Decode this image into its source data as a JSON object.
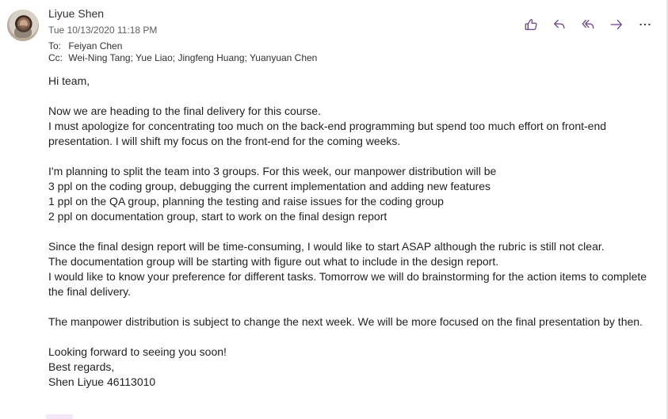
{
  "message": {
    "sender": "Liyue Shen",
    "date": "Tue 10/13/2020 11:18 PM",
    "to_label": "To:",
    "to": "Feiyan Chen",
    "cc_label": "Cc:",
    "cc": "Wei-Ning Tang; Yue Liao; Jingfeng Huang; Yuanyuan Chen"
  },
  "actions": [
    {
      "name": "like-button",
      "icon": "thumbs-up-icon"
    },
    {
      "name": "reply-button",
      "icon": "reply-icon"
    },
    {
      "name": "reply-all-button",
      "icon": "reply-all-icon"
    },
    {
      "name": "forward-button",
      "icon": "forward-icon"
    },
    {
      "name": "more-actions-button",
      "icon": "more-icon"
    }
  ],
  "accent_color": "#6a3f8a",
  "body": {
    "greeting": "Hi team,",
    "p1_line1": "Now we are heading to the final delivery for this course.",
    "p1_line2": "I must apologize for concentrating too much on the back-end programming but spend too much effort on front-end presentation. I will shift my focus on the front-end for the coming weeks.",
    "p2_line1": "I'm planning to split the team into 3 groups. For this week, our manpower distribution will be",
    "p2_line2": "3 ppl on the coding group, debugging the current implementation and adding new features",
    "p2_line3": "1 ppl on the QA group, planning the testing and raise issues for the coding group",
    "p2_line4": "2 ppl on documentation group, start to work on the final design report",
    "p3_line1": "Since the final design report will be time-consuming, I would like to start ASAP although the rubric is still not clear.",
    "p3_line2": "The documentation group will be starting with figure out what to include in the design report.",
    "p3_line3": "I would like to know your preference for different tasks. Tomorrow we will do brainstorming for the action items to complete the final delivery.",
    "p4_line1": "The manpower distribution is subject to change the next week. We will be more focused on the final presentation by then.",
    "closing1": "Looking forward to seeing you soon!",
    "closing2": "Best regards,",
    "signature": "Shen Liyue 46113010"
  }
}
